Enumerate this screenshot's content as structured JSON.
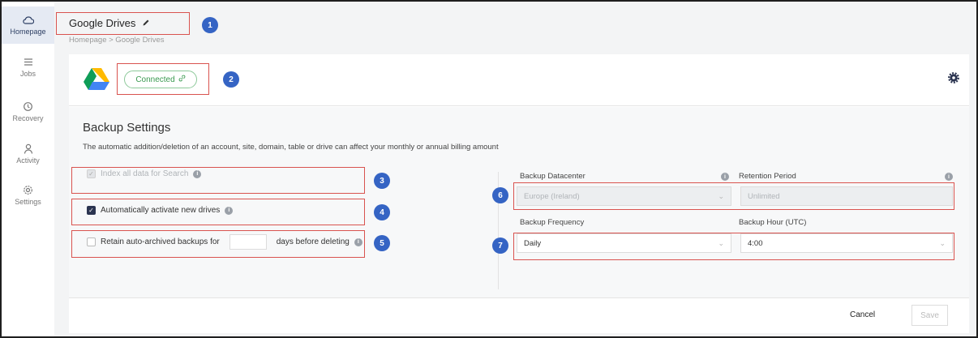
{
  "sidebar": {
    "items": [
      {
        "label": "Homepage",
        "icon": "cloud-icon",
        "active": true
      },
      {
        "label": "Jobs",
        "icon": "list-icon",
        "active": false
      },
      {
        "label": "Recovery",
        "icon": "recovery-icon",
        "active": false
      },
      {
        "label": "Activity",
        "icon": "person-icon",
        "active": false
      },
      {
        "label": "Settings",
        "icon": "gear-icon",
        "active": false
      }
    ]
  },
  "header": {
    "title": "Google Drives",
    "breadcrumb": "Homepage > Google Drives"
  },
  "connection": {
    "status": "Connected"
  },
  "backup_settings": {
    "title": "Backup Settings",
    "description": "The automatic addition/deletion of an account, site, domain, table or drive can affect your monthly or annual billing amount",
    "index_all": {
      "label": "Index all data for Search",
      "checked": true,
      "disabled": true
    },
    "auto_activate": {
      "label": "Automatically activate new drives",
      "checked": true
    },
    "retain": {
      "label_before": "Retain auto-archived backups for",
      "label_after": "days before deleting",
      "checked": false,
      "days_value": ""
    },
    "datacenter": {
      "label": "Backup Datacenter",
      "value": "Europe (Ireland)"
    },
    "retention": {
      "label": "Retention Period",
      "value": "Unlimited"
    },
    "frequency": {
      "label": "Backup Frequency",
      "value": "Daily"
    },
    "hour": {
      "label": "Backup Hour (UTC)",
      "value": "4:00"
    }
  },
  "footer": {
    "cancel_label": "Cancel",
    "save_label": "Save"
  },
  "annotations": [
    "1",
    "2",
    "3",
    "4",
    "5",
    "6",
    "7"
  ],
  "colors": {
    "accent": "#2b3450",
    "connected_green": "#3a9a50",
    "annotation_red": "#d9534f",
    "badge_blue": "#3564c4"
  }
}
